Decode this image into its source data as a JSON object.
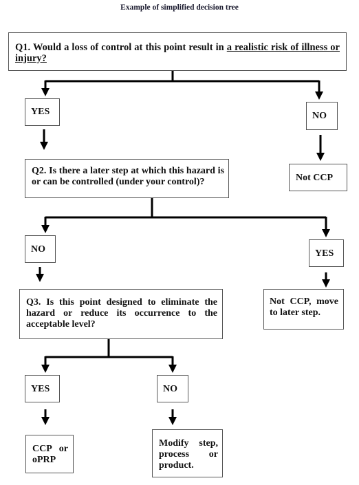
{
  "title": "Example of simplified decision tree",
  "nodes": {
    "q1": {
      "prefix": "Q1. Would a loss of control at this point result in ",
      "underlined": "a realistic risk of illness or injury?"
    },
    "q1_yes": {
      "label": "YES"
    },
    "q1_no": {
      "label": "NO"
    },
    "not_ccp": {
      "label": "Not CCP"
    },
    "q2": {
      "text": "Q2. Is there a later step at which this hazard is or can be controlled (under your control)?"
    },
    "q2_no": {
      "label": "NO"
    },
    "q2_yes": {
      "label": "YES"
    },
    "not_ccp_move": {
      "text": "Not CCP, move to later step."
    },
    "q3": {
      "text": "Q3. Is this point designed to eliminate the hazard or reduce its occurrence to the acceptable level?"
    },
    "q3_yes": {
      "label": "YES"
    },
    "q3_no": {
      "label": "NO"
    },
    "ccp_oprp": {
      "text": "CCP or oPRP"
    },
    "modify": {
      "text": "Modify step, process or product."
    }
  }
}
